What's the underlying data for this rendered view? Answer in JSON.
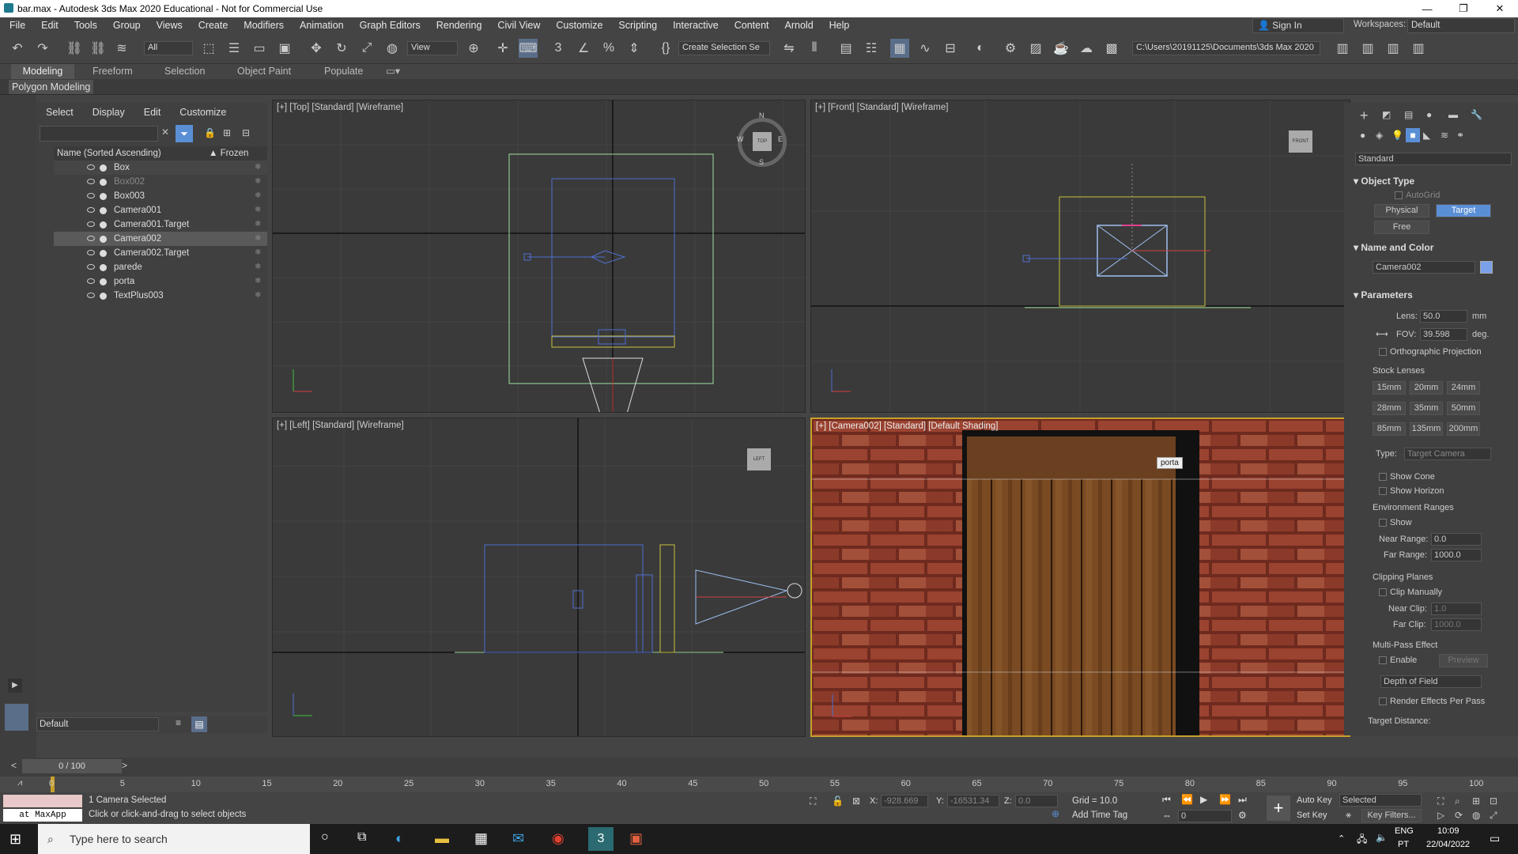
{
  "window": {
    "title": "bar.max - Autodesk 3ds Max 2020 Educational - Not for Commercial Use"
  },
  "menu": [
    "File",
    "Edit",
    "Tools",
    "Group",
    "Views",
    "Create",
    "Modifiers",
    "Animation",
    "Graph Editors",
    "Rendering",
    "Civil View",
    "Customize",
    "Scripting",
    "Interactive",
    "Content",
    "Arnold",
    "Help"
  ],
  "account": {
    "sign_in": "Sign In",
    "workspaces_label": "Workspaces:",
    "workspace": "Default"
  },
  "toolbar": {
    "filter": "All",
    "view": "View",
    "create_selection": "Create Selection Se",
    "path": "C:\\Users\\20191125\\Documents\\3ds Max 2020"
  },
  "ribbon": {
    "tabs": [
      "Modeling",
      "Freeform",
      "Selection",
      "Object Paint",
      "Populate"
    ],
    "sub": "Polygon Modeling"
  },
  "explorer": {
    "menu": [
      "Select",
      "Display",
      "Edit",
      "Customize"
    ],
    "col_name": "Name (Sorted Ascending)",
    "col_frozen": "▲ Frozen",
    "rows": [
      {
        "name": "Box"
      },
      {
        "name": "Box002"
      },
      {
        "name": "Box003"
      },
      {
        "name": "Camera001"
      },
      {
        "name": "Camera001.Target"
      },
      {
        "name": "Camera002"
      },
      {
        "name": "Camera002.Target"
      },
      {
        "name": "parede"
      },
      {
        "name": "porta"
      },
      {
        "name": "TextPlus003"
      }
    ],
    "layer": "Default"
  },
  "viewports": {
    "top": "[+] [Top] [Standard] [Wireframe]",
    "front": "[+] [Front] [Standard] [Wireframe]",
    "left": "[+] [Left] [Standard] [Wireframe]",
    "camera": "[+] [Camera002] [Standard] [Default Shading]",
    "tooltip": "porta",
    "compass": {
      "n": "N",
      "s": "S",
      "e": "E",
      "w": "W",
      "label": "TOP"
    },
    "front_cube": "FRONT",
    "left_cube": "LEFT"
  },
  "cmd": {
    "category": "Standard",
    "object_type": "Object Type",
    "autogrid": "AutoGrid",
    "physical": "Physical",
    "target": "Target",
    "free": "Free",
    "name_color": "Name and Color",
    "name": "Camera002",
    "parameters": "Parameters",
    "lens_label": "Lens:",
    "lens": "50.0",
    "lens_unit": "mm",
    "fov_label": "FOV:",
    "fov": "39.598",
    "fov_unit": "deg.",
    "ortho": "Orthographic Projection",
    "stock_lenses": "Stock Lenses",
    "lenses": [
      "15mm",
      "20mm",
      "24mm",
      "28mm",
      "35mm",
      "50mm",
      "85mm",
      "135mm",
      "200mm"
    ],
    "type_label": "Type:",
    "type": "Target Camera",
    "show_cone": "Show Cone",
    "show_horizon": "Show Horizon",
    "env_ranges": "Environment Ranges",
    "show": "Show",
    "near_range_label": "Near Range:",
    "near_range": "0.0",
    "far_range_label": "Far Range:",
    "far_range": "1000.0",
    "clipping": "Clipping Planes",
    "clip_manually": "Clip Manually",
    "near_clip_label": "Near Clip:",
    "near_clip": "1.0",
    "far_clip_label": "Far Clip:",
    "far_clip": "1000.0",
    "multipass": "Multi-Pass Effect",
    "enable": "Enable",
    "preview": "Preview",
    "dof": "Depth of Field",
    "render_effects": "Render Effects Per Pass",
    "target_distance": "Target Distance:"
  },
  "timeline": {
    "frame": "0 / 100",
    "ticks": [
      "0",
      "5",
      "10",
      "15",
      "20",
      "25",
      "30",
      "35",
      "40",
      "45",
      "50",
      "55",
      "60",
      "65",
      "70",
      "75",
      "80",
      "85",
      "90",
      "95",
      "100"
    ]
  },
  "status": {
    "maxscript": "at MaxApp",
    "selected": "1 Camera Selected",
    "prompt": "Click or click-and-drag to select objects",
    "x_label": "X:",
    "x": "-928.669",
    "y_label": "Y:",
    "y": "-16531.34",
    "z_label": "Z:",
    "z": "0.0",
    "grid": "Grid = 10.0",
    "add_time_tag": "Add Time Tag",
    "auto_key": "Auto Key",
    "set_key": "Set Key",
    "key_mode": "Selected",
    "key_filters": "Key Filters...",
    "frame_field": "0"
  },
  "taskbar": {
    "search": "Type here to search",
    "lang1": "ENG",
    "lang2": "PT",
    "time": "10:09",
    "date": "22/04/2022"
  },
  "colors": {
    "accent": "#5a8fd6",
    "selection_border": "#c8a02a",
    "brick": "#8a3b2a",
    "wood": "#7a4a22"
  }
}
